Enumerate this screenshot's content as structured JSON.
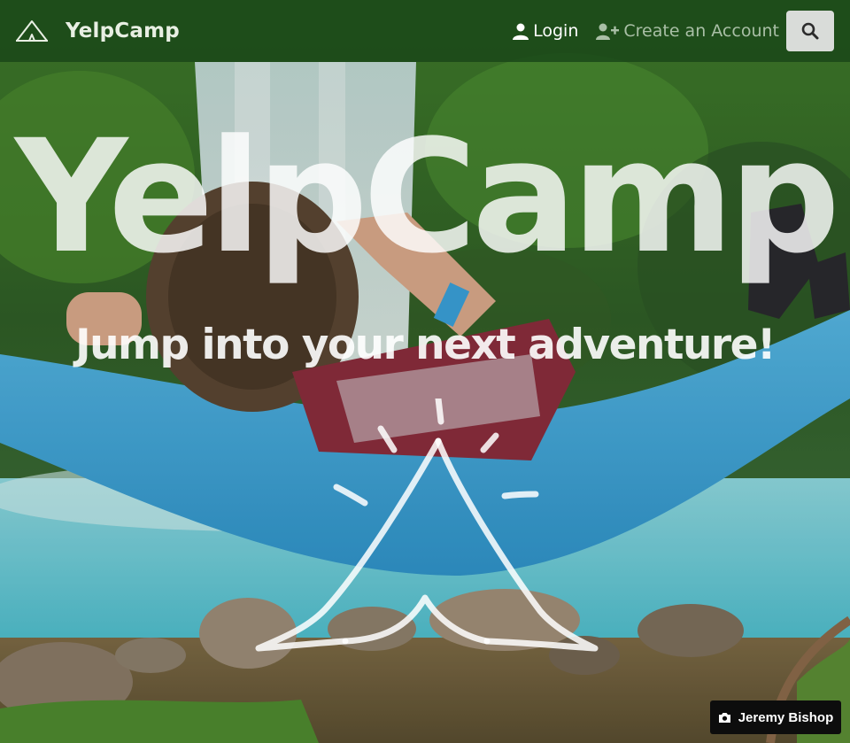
{
  "navbar": {
    "brand_name": "YelpCamp",
    "login_label": "Login",
    "register_label": "Create an Account",
    "brand_icon": "tent-logo-icon",
    "login_icon": "user-icon",
    "register_icon": "user-plus-icon",
    "search_icon": "search-icon"
  },
  "hero": {
    "title": "YelpCamp",
    "subtitle": "Jump into your next adventure!",
    "logo_icon": "tent-logo-icon"
  },
  "credit": {
    "label": "Jeremy Bishop",
    "icon": "camera-icon"
  },
  "colors": {
    "navbar_bg": "#184618",
    "search_button_bg": "#d9dcd9",
    "credit_bg": "#0d0d0d",
    "hammock": "#3fa6d8",
    "water": "#5ec9d6"
  }
}
